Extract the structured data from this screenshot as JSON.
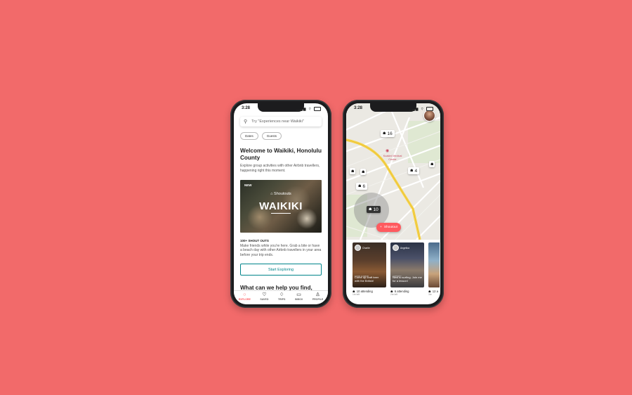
{
  "colors": {
    "background": "#f26a6a",
    "brand": "#ff5a5f",
    "teal": "#00848a"
  },
  "left_phone": {
    "time": "3:28",
    "search_placeholder": "Try \"Experiences near Waikiki\"",
    "chips": [
      "Dates",
      "Guests"
    ],
    "welcome_title": "Welcome to Waikiki, Honolulu County",
    "welcome_desc": "Explore group activities with other Airbnb travellers, happening right this moment.",
    "hero": {
      "badge": "NEW",
      "brand": "Shoutouts",
      "title": "WAIKIKI"
    },
    "shout_heading": "100+ SHOUT OUTS",
    "shout_desc": "Make friends while you're here. Grab a bite or have a beach day with other Airbnb travellers in your area before your trip ends.",
    "cta_label": "Start Exploring",
    "help_heading": "What can we help you find,",
    "tabs": [
      {
        "label": "EXPLORE",
        "icon": "search-icon"
      },
      {
        "label": "SAVED",
        "icon": "heart-icon"
      },
      {
        "label": "TRIPS",
        "icon": "airbnb-logo-icon"
      },
      {
        "label": "INBOX",
        "icon": "chat-icon"
      },
      {
        "label": "PROFILE",
        "icon": "person-icon"
      }
    ]
  },
  "right_phone": {
    "time": "3:28",
    "pins": {
      "a": "16",
      "b": "4",
      "c": "6",
      "d": "10"
    },
    "poi_label": "Kuakini Medical Center",
    "shoutout_label": "Shoutout",
    "cards": [
      {
        "user": "Charlie",
        "tag": "FOOD & DRINK",
        "text": "Come up craft beer with the British!",
        "distance": "0.5mi away",
        "attending": "10 attending",
        "left": "1hr left"
      },
      {
        "user": "Angelica",
        "tag": "ACTIVITY",
        "text": "New to surfing. Join me for a lesson!",
        "distance": "2mi away",
        "attending": "6 attending",
        "left": "2hr left"
      },
      {
        "user": "",
        "tag": "",
        "text": "",
        "distance": "",
        "attending": "12 a",
        "left": "3hr"
      }
    ]
  }
}
